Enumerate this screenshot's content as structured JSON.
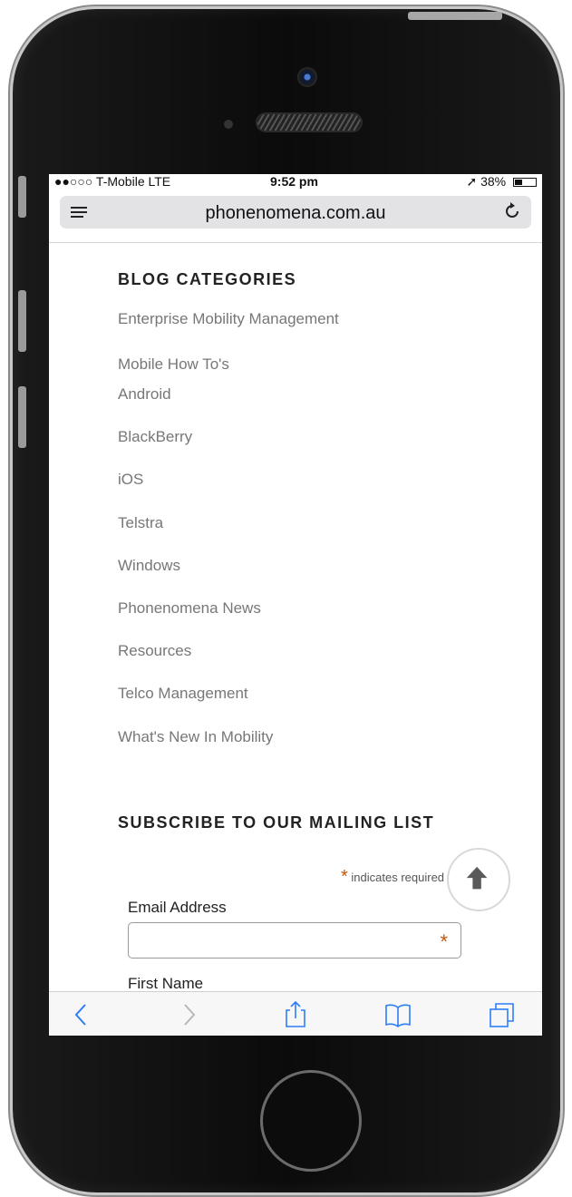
{
  "status_bar": {
    "carrier": "●●○○○ T-Mobile  LTE",
    "time": "9:52 pm",
    "battery": "38%",
    "battery_level": 0.38
  },
  "browser": {
    "url": "phonenomena.com.au"
  },
  "blog": {
    "title": "BLOG CATEGORIES",
    "categories": [
      "Enterprise Mobility Management",
      "Mobile How To's",
      "Android",
      "BlackBerry",
      "iOS",
      "Telstra",
      "Windows",
      "Phonenomena News",
      "Resources",
      "Telco Management",
      "What's New In Mobility"
    ]
  },
  "subscribe": {
    "title": "SUBSCRIBE TO OUR MAILING LIST",
    "required_star": "*",
    "required_note": " indicates required",
    "email_label": "Email Address",
    "email_value": "",
    "first_name_label": "First Name"
  },
  "colors": {
    "accent": "#2d7df6",
    "required": "#c0590b"
  },
  "icons": {
    "menu": "hamburger-icon",
    "reload": "reload-icon",
    "back": "chevron-left-icon",
    "forward": "chevron-right-icon",
    "share": "share-icon",
    "bookmarks": "book-icon",
    "tabs": "tabs-icon",
    "scroll_top": "arrow-up-icon"
  }
}
